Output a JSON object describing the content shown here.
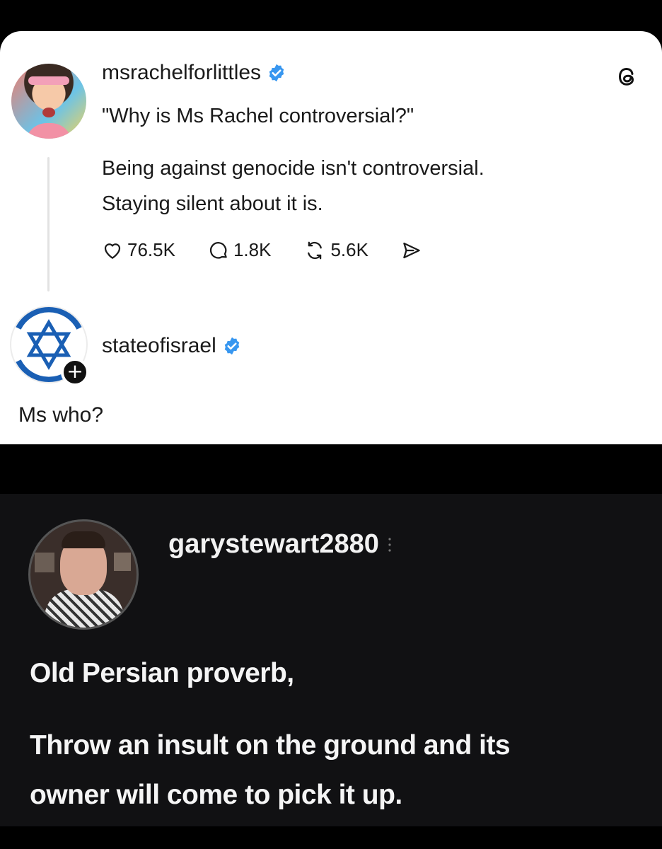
{
  "threads_post": {
    "author": {
      "username": "msrachelforlittles",
      "verified": true,
      "avatar_icon": "profile-photo-ms-rachel"
    },
    "app_icon": "threads-logo-icon",
    "quote": "\"Why is Ms Rachel controversial?\"",
    "body_lines": [
      "Being against genocide isn't controversial.",
      "Staying silent about it is."
    ],
    "actions": {
      "likes": "76.5K",
      "comments": "1.8K",
      "reposts": "5.6K",
      "like_icon": "heart-icon",
      "comment_icon": "comment-bubble-icon",
      "repost_icon": "repost-icon",
      "share_icon": "send-icon"
    },
    "reply": {
      "username": "stateofisrael",
      "verified": true,
      "avatar_icon": "star-of-david-icon",
      "follow_icon": "plus-icon",
      "follow_label": "+",
      "text": "Ms who?"
    }
  },
  "comment": {
    "username": "garystewart2880",
    "more_icon": "more-vertical-icon",
    "lines": [
      "Old Persian proverb,",
      "Throw an insult on the ground and its",
      "owner will come to pick it up."
    ]
  },
  "colors": {
    "verified_blue": "#3897f0",
    "israel_blue": "#1a5fb4",
    "dark_bg": "#111113",
    "card_bg": "#ffffff"
  }
}
